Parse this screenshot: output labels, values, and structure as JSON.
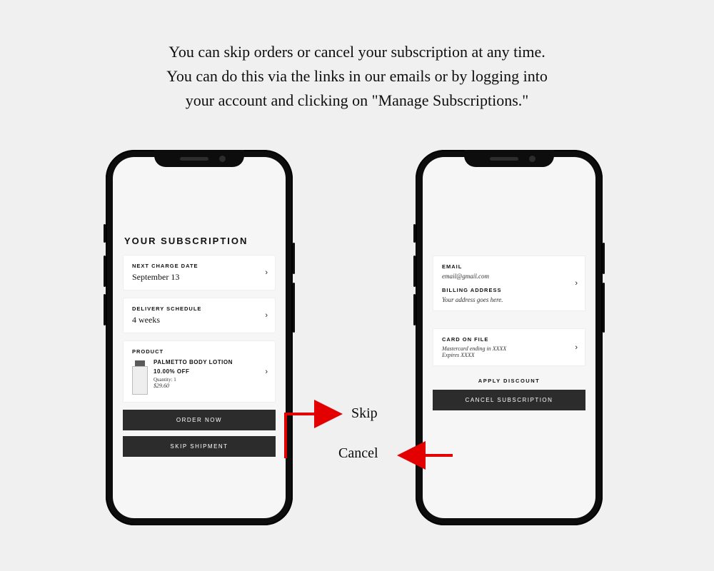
{
  "instruction": {
    "line1": "You can skip orders or cancel your subscription at any time.",
    "line2": "You can do this via the links in our emails or by logging into",
    "line3": "your account and clicking on \"Manage Subscriptions.\""
  },
  "left_phone": {
    "title": "YOUR SUBSCRIPTION",
    "next_charge_label": "NEXT CHARGE DATE",
    "next_charge_value": "September 13",
    "delivery_label": "DELIVERY SCHEDULE",
    "delivery_value": "4 weeks",
    "product_label": "PRODUCT",
    "product_name": "PALMETTO BODY LOTION",
    "product_discount": "10.00% OFF",
    "product_qty": "Quantity: 1",
    "product_price": "$29.60",
    "order_now_btn": "ORDER NOW",
    "skip_shipment_btn": "SKIP SHIPMENT"
  },
  "right_phone": {
    "email_label": "EMAIL",
    "email_value": "email@gmail.com",
    "billing_label": "BILLING ADDRESS",
    "billing_value": "Your address goes here.",
    "card_label": "CARD ON FILE",
    "card_line1": "Mastercard ending in  XXXX",
    "card_line2": "Expires  XXXX",
    "apply_discount": "APPLY DISCOUNT",
    "cancel_btn": "CANCEL SUBSCRIPTION"
  },
  "annotations": {
    "skip": "Skip",
    "cancel": "Cancel"
  },
  "colors": {
    "arrow": "#e30000",
    "btn_bg": "#2c2c2c"
  }
}
